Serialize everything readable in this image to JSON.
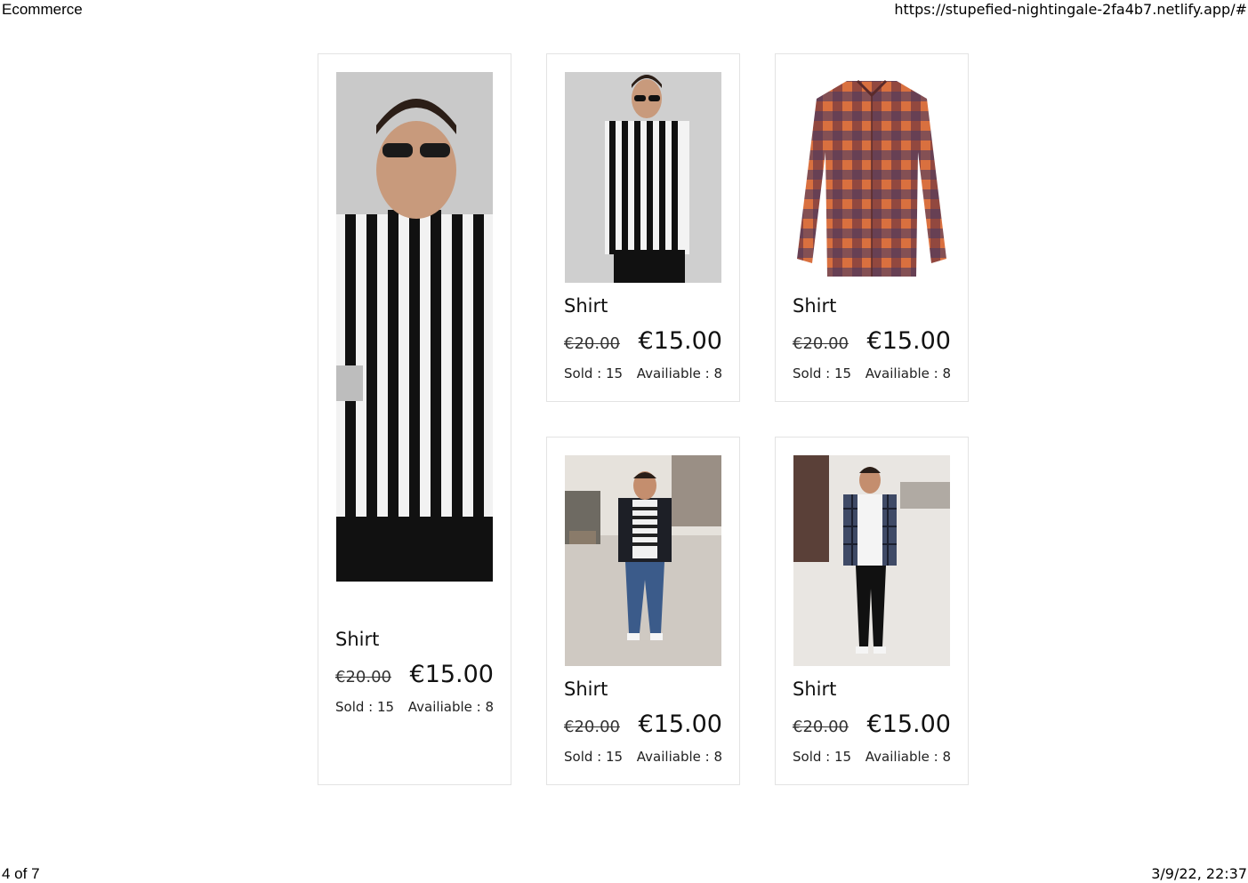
{
  "header": {
    "page_title": "Ecommerce",
    "url": "https://stupefied-nightingale-2fa4b7.netlify.app/#"
  },
  "footer": {
    "page_counter": "4 of 7",
    "datetime": "3/9/22, 22:37"
  },
  "products": [
    {
      "title": "Shirt",
      "old_price": "€20.00",
      "price": "€15.00",
      "sold": "Sold : 15",
      "available": "Availiable : 8",
      "image": "striped-shirt-model-closeup"
    },
    {
      "title": "Shirt",
      "old_price": "€20.00",
      "price": "€15.00",
      "sold": "Sold : 15",
      "available": "Availiable : 8",
      "image": "striped-shirt-model-full"
    },
    {
      "title": "Shirt",
      "old_price": "€20.00",
      "price": "€15.00",
      "sold": "Sold : 15",
      "available": "Availiable : 8",
      "image": "plaid-flannel-shirt"
    },
    {
      "title": "Shirt",
      "old_price": "€20.00",
      "price": "€15.00",
      "sold": "Sold : 15",
      "available": "Availiable : 8",
      "image": "street-style-blazer-jeans"
    },
    {
      "title": "Shirt",
      "old_price": "€20.00",
      "price": "€15.00",
      "sold": "Sold : 15",
      "available": "Availiable : 8",
      "image": "street-style-plaid-black-jeans"
    }
  ]
}
